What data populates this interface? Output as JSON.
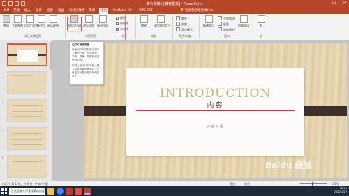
{
  "app": {
    "title": "演示文稿1 [兼容模式] - PowerPoint",
    "window_buttons": [
      "—",
      "☐",
      "✕"
    ]
  },
  "ribbon_tabs": [
    {
      "label": "文件"
    },
    {
      "label": "开始"
    },
    {
      "label": "插入"
    },
    {
      "label": "设计"
    },
    {
      "label": "切换"
    },
    {
      "label": "动画"
    },
    {
      "label": "幻灯片放映"
    },
    {
      "label": "审阅"
    },
    {
      "label": "视图"
    },
    {
      "label": "EndNote X9"
    },
    {
      "label": "WPS PDF"
    }
  ],
  "tell_me": "告诉我您想要做什么",
  "ribbon": {
    "presentation_views": {
      "group_label": "演示文稿视图",
      "buttons": [
        "普通",
        "大纲视图",
        "幻灯片浏览",
        "备注页",
        "阅读视图"
      ]
    },
    "master_views": {
      "group_label": "母版视图",
      "buttons": [
        "幻灯片母版",
        "讲义母版",
        "备注母版"
      ]
    },
    "show": {
      "group_label": "显示",
      "items": [
        "标尺",
        "网格线",
        "参考线"
      ]
    },
    "zoom": {
      "group_label": "缩放",
      "buttons": [
        "缩放",
        "适应窗口大小"
      ]
    },
    "color": {
      "group_label": "颜色/灰度",
      "items": [
        "颜色",
        "灰度",
        "黑白模式"
      ]
    },
    "window": {
      "group_label": "窗口",
      "new_window": "新建窗口",
      "items": [
        "全部重排",
        "层叠",
        "移动拆分"
      ],
      "switch_window": "切换窗口"
    },
    "macros": {
      "group_label": "宏",
      "button": "宏"
    }
  },
  "tooltip": {
    "title": "幻灯片母版视图",
    "paragraphs": [
      "母版幻灯片控制整个演示文稿的外观，包括颜色、字体、背景、效果和其他所有内容。",
      "您可以在幻灯片母版上插入形状或徽标等内容，它就会自动显示在所有幻灯片上。"
    ]
  },
  "thumbnails": [
    {
      "number": "1"
    },
    {
      "number": "2"
    },
    {
      "number": "3"
    },
    {
      "number": "4"
    },
    {
      "number": "5"
    }
  ],
  "slide": {
    "title": "INTRODUCTION",
    "subtitle": "内容",
    "author": "汪岐与青"
  },
  "status": {
    "slide_info": "幻灯片 第 1 张，共 6 张",
    "language": "中文(中国)",
    "notes": "备注",
    "comments": "批注",
    "zoom": "104%"
  },
  "taskbar": {
    "search_placeholder": "在这里输入你要搜索的内容",
    "apps": [
      "文件资源管理器",
      "Chrome",
      "WPS",
      "网易云音乐",
      "PowerPoint"
    ],
    "time": "18:16",
    "date": "2020/1/22"
  },
  "colors": {
    "accent": "#b7472a",
    "title_gold": "#d4b274",
    "rule_red": "#b04a3e",
    "wood_band": "#3e3028"
  },
  "watermark": "Baidu 经验"
}
